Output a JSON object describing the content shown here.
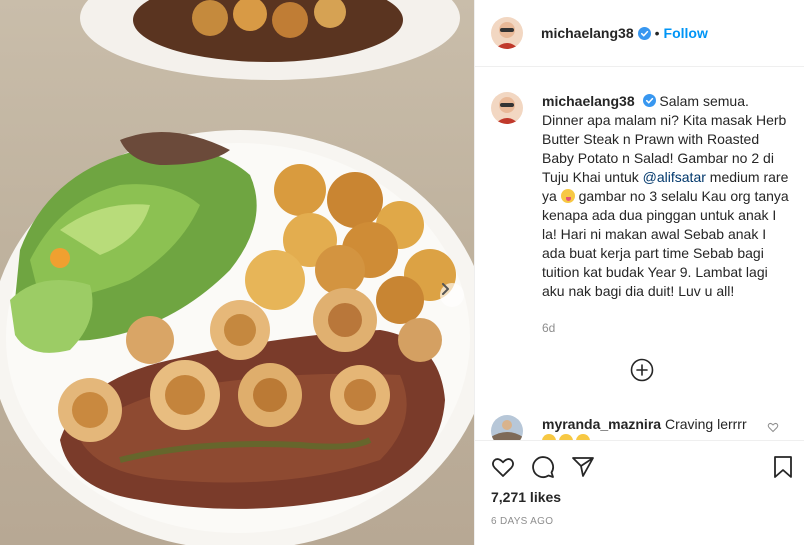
{
  "post": {
    "username": "michaelang38",
    "follow_label": "Follow",
    "separator": "•",
    "photo_alt": "Herb Butter Steak n Prawn with Roasted Baby Potato n Salad"
  },
  "caption": {
    "username": "michaelang38",
    "text_part1": "Salam semua. Dinner apa malam ni? Kita masak Herb Butter Steak n Prawn with Roasted Baby Potato n Salad! Gambar no 2 di Tuju Khai untuk ",
    "mention": "@alifsatar",
    "text_part2": " medium rare ya ",
    "text_part3": " gambar no 3 selalu Kau org tanya kenapa ada dua pinggan untuk anak I la! Hari ni makan awal Sebab anak I ada buat kerja part time Sebab bagi tuition kat budak Year 9. Lambat lagi aku nak bagi dia duit! Luv u all!",
    "time": "6d"
  },
  "comment": {
    "username": "myranda_maznira",
    "text": "Craving lerrrr"
  },
  "footer": {
    "likes": "7,271 likes",
    "date": "6 DAYS AGO"
  },
  "icons": {
    "verified": "verified-badge-icon",
    "heart": "heart-icon",
    "comment": "comment-icon",
    "share": "share-icon",
    "save": "bookmark-icon",
    "load_more": "plus-circle-icon",
    "next": "chevron-right-icon"
  },
  "colors": {
    "link": "#0095f6",
    "mention": "#00376b",
    "muted": "#8e8e8e",
    "border": "#efefef"
  }
}
